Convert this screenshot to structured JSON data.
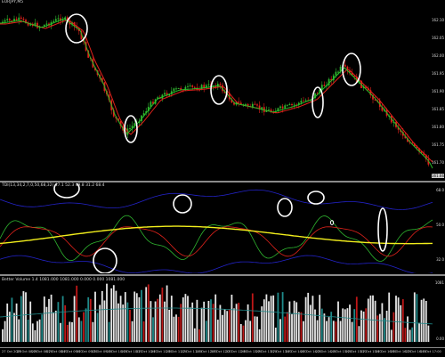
{
  "chart": {
    "symbol_label": "EURJPY,M5",
    "price_axis": [
      "162.10",
      "162.05",
      "162.00",
      "161.95",
      "161.90",
      "161.85",
      "161.80",
      "161.75",
      "161.70"
    ],
    "price_axis_highlight": "161.66",
    "oscillator_label": "TDI(13,34,2,7,0,50,68,32) 47.1 52.3 49.8 31.2 68.4",
    "oscillator_axis": [
      "68.0",
      "50.0",
      "32.0"
    ],
    "volume_label": "Better Volume 1.4 1081.000 1081.000 0.000 0.000 1081.000",
    "volume_axis": [
      "1081",
      "0.00"
    ],
    "time_axis": [
      "27 Oct 2020",
      "27 Oct 08:00",
      "27 Oct 08:20",
      "27 Oct 08:40",
      "27 Oct 09:00",
      "27 Oct 09:20",
      "27 Oct 09:40",
      "27 Oct 10:00",
      "27 Oct 10:20",
      "27 Oct 10:40",
      "27 Oct 11:00",
      "27 Oct 11:20",
      "27 Oct 11:40",
      "27 Oct 12:00",
      "27 Oct 12:20",
      "27 Oct 12:40",
      "27 Oct 13:00",
      "27 Oct 13:20",
      "27 Oct 13:40",
      "27 Oct 14:00",
      "27 Oct 14:20",
      "27 Oct 14:40",
      "27 Oct 15:00",
      "27 Oct 15:20",
      "27 Oct 15:40",
      "27 Oct 16:00",
      "27 Oct 16:20",
      "27 Oct 16:40",
      "27 Oct 17:00"
    ],
    "colors": {
      "bull": "#2fb52f",
      "bear": "#e0221b",
      "ema_fast": "#28c428",
      "ema_slow": "#e0221b",
      "band": "#2323c8",
      "signal": "#f2ee1c",
      "vol_white": "#e6e6e6",
      "vol_red": "#c01818",
      "vol_teal": "#1f8a8a",
      "grid_sep": "#8a8a8a",
      "annotation": "#ffffff"
    },
    "annotations_note_icon": "white-circle"
  }
}
